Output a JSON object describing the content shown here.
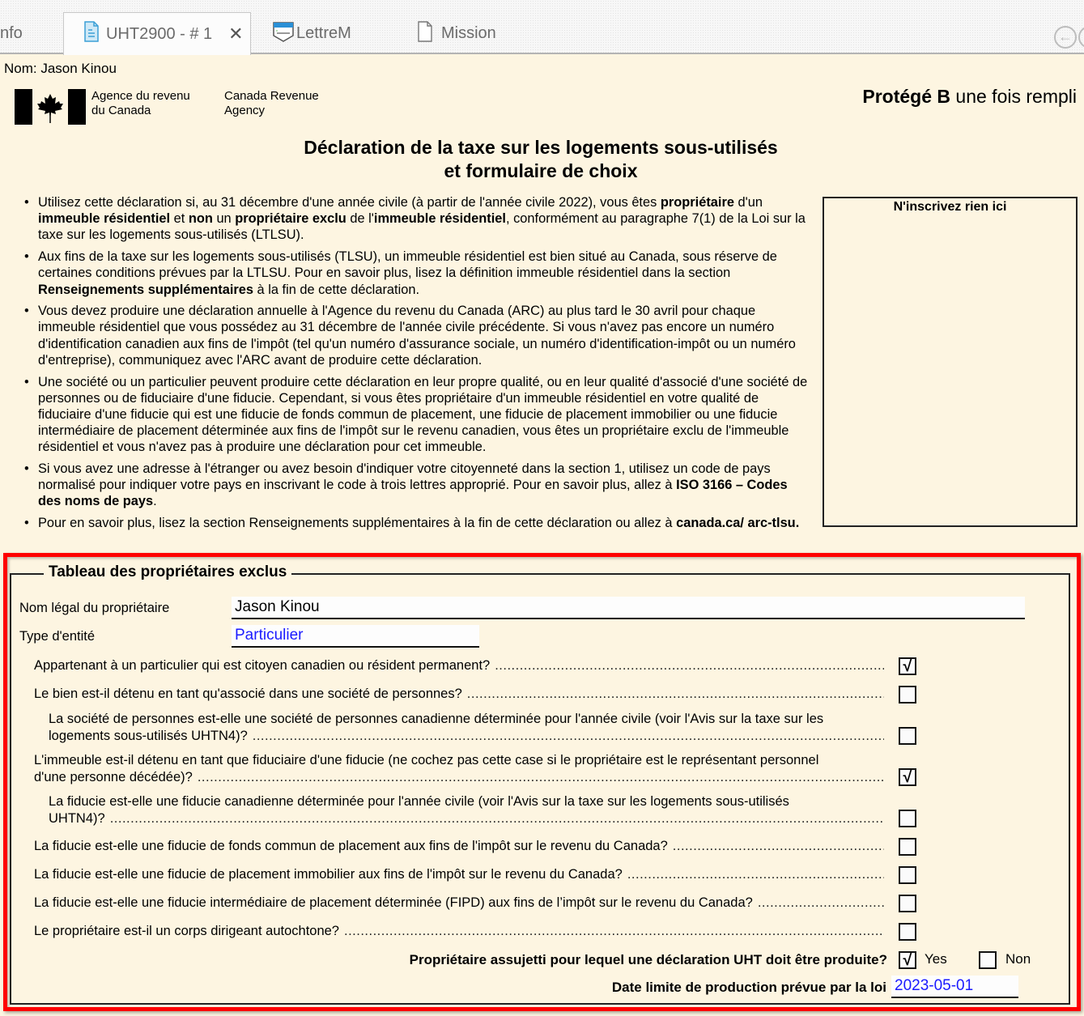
{
  "tabs": [
    {
      "label": "nfo",
      "icon": "none",
      "active": false
    },
    {
      "label": "UHT2900 - # 1",
      "icon": "document-icon",
      "active": true,
      "close": "✕"
    },
    {
      "label": "LettreM",
      "icon": "letter-template-icon",
      "active": false
    },
    {
      "label": "Mission",
      "icon": "blank-document-icon",
      "active": false
    }
  ],
  "nav": {
    "back": "←"
  },
  "header": {
    "nom": "Nom: Jason Kinou",
    "agency_fr_1": "Agence du revenu",
    "agency_fr_2": "du Canada",
    "agency_en_1": "Canada Revenue",
    "agency_en_2": "Agency",
    "protege_bold": "Protégé B",
    "protege_rest": " une fois rempli",
    "title_1": "Déclaration de la taxe sur les logements sous-utilisés",
    "title_2": "et formulaire de choix"
  },
  "bullets": [
    [
      {
        "t": "Utilisez cette déclaration si, au 31 décembre d'une année civile (à partir de l'année civile 2022), vous êtes "
      },
      {
        "t": "propriétaire",
        "b": true
      },
      {
        "t": " d'un "
      },
      {
        "t": "immeuble résidentiel",
        "b": true
      },
      {
        "t": " et "
      },
      {
        "t": "non",
        "b": true
      },
      {
        "t": " un "
      },
      {
        "t": "propriétaire exclu",
        "b": true
      },
      {
        "t": " de l'"
      },
      {
        "t": "immeuble résidentiel",
        "b": true
      },
      {
        "t": ", conformément au paragraphe 7(1) de la Loi sur la taxe sur les logements sous-utilisés (LTLSU)."
      }
    ],
    [
      {
        "t": "Aux fins de la taxe sur les logements sous-utilisés (TLSU), un immeuble résidentiel est bien situé au Canada, sous réserve de certaines conditions prévues par la LTLSU. Pour en savoir plus, lisez la définition immeuble résidentiel dans la section "
      },
      {
        "t": "Renseignements supplémentaires",
        "b": true
      },
      {
        "t": " à la fin de cette déclaration."
      }
    ],
    [
      {
        "t": "Vous devez produire une déclaration annuelle à l'Agence du revenu du Canada (ARC) au plus tard le 30 avril pour chaque immeuble résidentiel que vous possédez au 31 décembre de l'année civile précédente. Si vous n'avez pas encore un numéro d'identification canadien aux fins de l'impôt (tel qu'un numéro d'assurance sociale, un numéro d'identification-impôt ou un numéro d'entreprise), communiquez avec l'ARC avant de produire cette déclaration."
      }
    ],
    [
      {
        "t": "Une société ou un particulier peuvent produire cette déclaration en leur propre qualité, ou en leur qualité d'associé d'une société de personnes ou de fiduciaire d'une fiducie. Cependant, si vous êtes propriétaire d'un immeuble résidentiel en votre qualité de fiduciaire d'une fiducie qui est une fiducie de fonds commun de placement, une fiducie de placement immobilier ou une fiducie intermédiaire de placement déterminée aux fins de l'impôt sur le revenu canadien, vous êtes un propriétaire exclu de l'immeuble résidentiel et vous n'avez pas à produire une déclaration pour cet immeuble."
      }
    ],
    [
      {
        "t": "Si vous avez une adresse à l'étranger ou avez besoin d'indiquer votre citoyenneté dans la section 1, utilisez un code de pays normalisé pour indiquer votre pays en inscrivant le code à trois lettres approprié. Pour en savoir plus, allez à "
      },
      {
        "t": "ISO 3166 – Codes des noms de pays",
        "b": true
      },
      {
        "t": "."
      }
    ],
    [
      {
        "t": "Pour en savoir plus, lisez la section Renseignements supplémentaires à la fin de cette déclaration ou allez à "
      },
      {
        "t": "canada.ca/ arc-tlsu.",
        "b": true
      }
    ]
  ],
  "nrien": "N'inscrivez rien ici",
  "section": {
    "legend": "Tableau des propriétaires exclus",
    "owner_label": "Nom légal du propriétaire",
    "owner_value": "Jason Kinou",
    "entity_label": "Type d'entité",
    "entity_value": "Particulier",
    "questions": [
      {
        "line1": "",
        "line2": "Appartenant à un particulier qui est citoyen canadien ou résident permanent?",
        "indent": false,
        "checked": true
      },
      {
        "line1": "",
        "line2": "Le bien est-il détenu en tant qu'associé dans une société de personnes?",
        "indent": false,
        "checked": false
      },
      {
        "line1": "La société de personnes est-elle une société de personnes canadienne déterminée pour l'année civile (voir l'Avis sur la taxe sur les",
        "line2": "logements sous-utilisés UHTN4)?",
        "indent": true,
        "checked": false
      },
      {
        "line1": "L'immeuble est-il détenu en tant que fiduciaire d'une fiducie (ne cochez pas cette case si le propriétaire est le représentant personnel",
        "line2": "d'une personne décédée)?",
        "indent": false,
        "checked": true
      },
      {
        "line1": "La fiducie est-elle une fiducie canadienne déterminée pour l'année civile (voir l'Avis sur la taxe sur les logements sous-utilisés",
        "line2": "UHTN4)?",
        "indent": true,
        "checked": false
      },
      {
        "line1": "",
        "line2": "La fiducie est-elle une fiducie de fonds commun de placement aux fins de l'impôt sur le revenu du Canada?",
        "indent": false,
        "checked": false
      },
      {
        "line1": "",
        "line2": "La fiducie est-elle une fiducie de placement immobilier aux fins de l'impôt sur le revenu du Canada?",
        "indent": false,
        "checked": false
      },
      {
        "line1": "",
        "line2": "La fiducie est-elle une fiducie intermédiaire de placement déterminée (FIPD) aux fins de l’impôt sur le revenu du Canada?",
        "indent": false,
        "checked": false
      },
      {
        "line1": "",
        "line2": "Le propriétaire est-il un corps dirigeant autochtone?",
        "indent": false,
        "checked": false
      }
    ],
    "subject_question": "Propriétaire assujetti pour lequel une déclaration UHT doit être produite?",
    "yes_label": "Yes",
    "yes_checked": true,
    "non_label": "Non",
    "non_checked": false,
    "deadline_label": "Date limite de production prévue par la loi",
    "deadline_value": "2023-05-01",
    "check_glyph": "√"
  },
  "colors": {
    "page_bg": "#fdf5e1",
    "highlight": "#ff0000",
    "input_value_blue": "#1a1aff"
  }
}
